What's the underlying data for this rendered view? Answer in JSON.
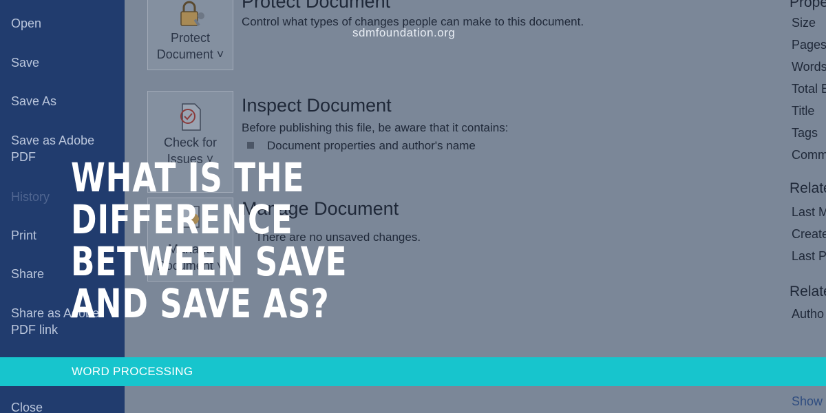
{
  "site": {
    "watermark": "sdmfoundation.org"
  },
  "sidebar": {
    "items": [
      {
        "label": "Open"
      },
      {
        "label": "Save"
      },
      {
        "label": "Save As"
      },
      {
        "label": "Save as Adobe\nPDF"
      },
      {
        "label": "History"
      },
      {
        "label": "Print"
      },
      {
        "label": "Share"
      },
      {
        "label": "Share as Adobe\nPDF link"
      },
      {
        "label": "Close"
      }
    ]
  },
  "main": {
    "protect": {
      "button_label": "Protect\nDocument ˅",
      "title": "Protect Document",
      "description": "Control what types of changes people can make to this document."
    },
    "inspect": {
      "button_label": "Check for\nIssues ˅",
      "title": "Inspect Document",
      "description": "Before publishing this file, be aware that it contains:",
      "bullet": "Document properties and author's name"
    },
    "manage": {
      "button_label": "Manage\nDocument ˅",
      "title": "Manage Document",
      "description": "There are no unsaved changes."
    }
  },
  "properties": {
    "heading": "Prope",
    "items": [
      "Size",
      "Pages",
      "Words",
      "Total E",
      "Title",
      "Tags",
      "Comm"
    ],
    "related_dates_heading": "Relate",
    "dates": [
      "Last M",
      "Create",
      "Last Pr"
    ],
    "related_people_heading": "Relate",
    "people": [
      "Autho"
    ],
    "show_link": "Show"
  },
  "article": {
    "headline": "What is the difference between Save and Save As?",
    "category": "WORD PROCESSING"
  },
  "colors": {
    "sidebar": "#213c6e",
    "accent": "#17c5cd"
  }
}
